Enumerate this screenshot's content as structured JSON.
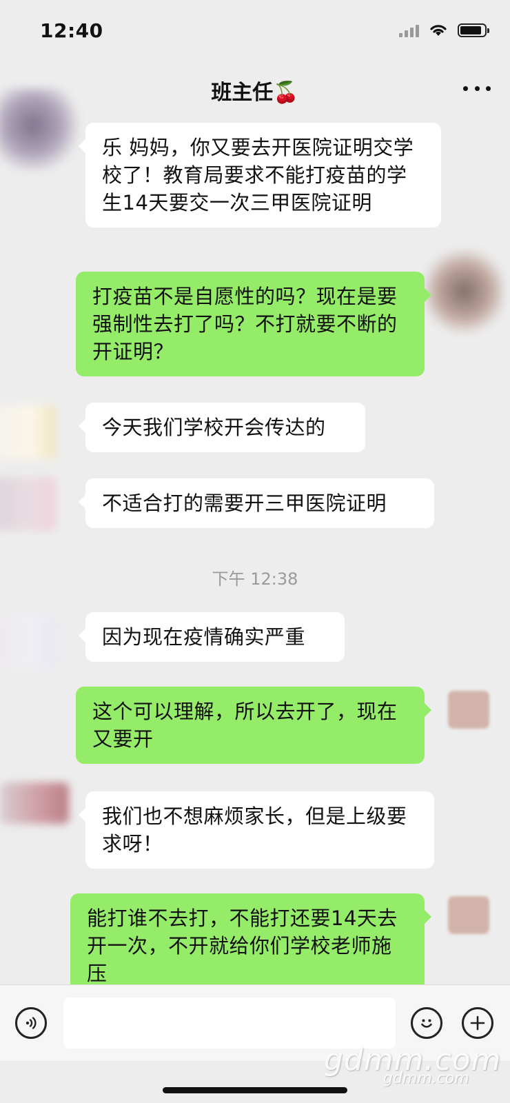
{
  "status_bar": {
    "time": "12:40"
  },
  "header": {
    "title": "班主任🍒"
  },
  "messages": [
    {
      "side": "left",
      "text": "乐 妈妈，你又要去开医院证明交学校了！教育局要求不能打疫苗的学生14天要交一次三甲医院证明"
    },
    {
      "side": "right",
      "text": "打疫苗不是自愿性的吗？现在是要强制性去打了吗？不打就要不断的开证明？"
    },
    {
      "side": "left",
      "text": "今天我们学校开会传达的"
    },
    {
      "side": "left",
      "text": "不适合打的需要开三甲医院证明"
    },
    {
      "side": "left",
      "text": "因为现在疫情确实严重"
    },
    {
      "side": "right",
      "text": "这个可以理解，所以去开了，现在又要开"
    },
    {
      "side": "left",
      "text": "我们也不想麻烦家长，但是上级要求呀！"
    },
    {
      "side": "right",
      "text": "能打谁不去打，不能打还要14天去开一次，不开就给你们学校老师施压"
    }
  ],
  "timestamp": "下午 12:38",
  "input_bar": {
    "voice_icon": "voice-icon",
    "emoji_icon": "emoji-icon",
    "plus_icon": "plus-icon",
    "value": ""
  },
  "watermark": {
    "main": "gdmm.com",
    "sub": "gdmm.com"
  },
  "colors": {
    "background": "#ededed",
    "bubble_right": "#95ec69",
    "bubble_left": "#ffffff"
  }
}
